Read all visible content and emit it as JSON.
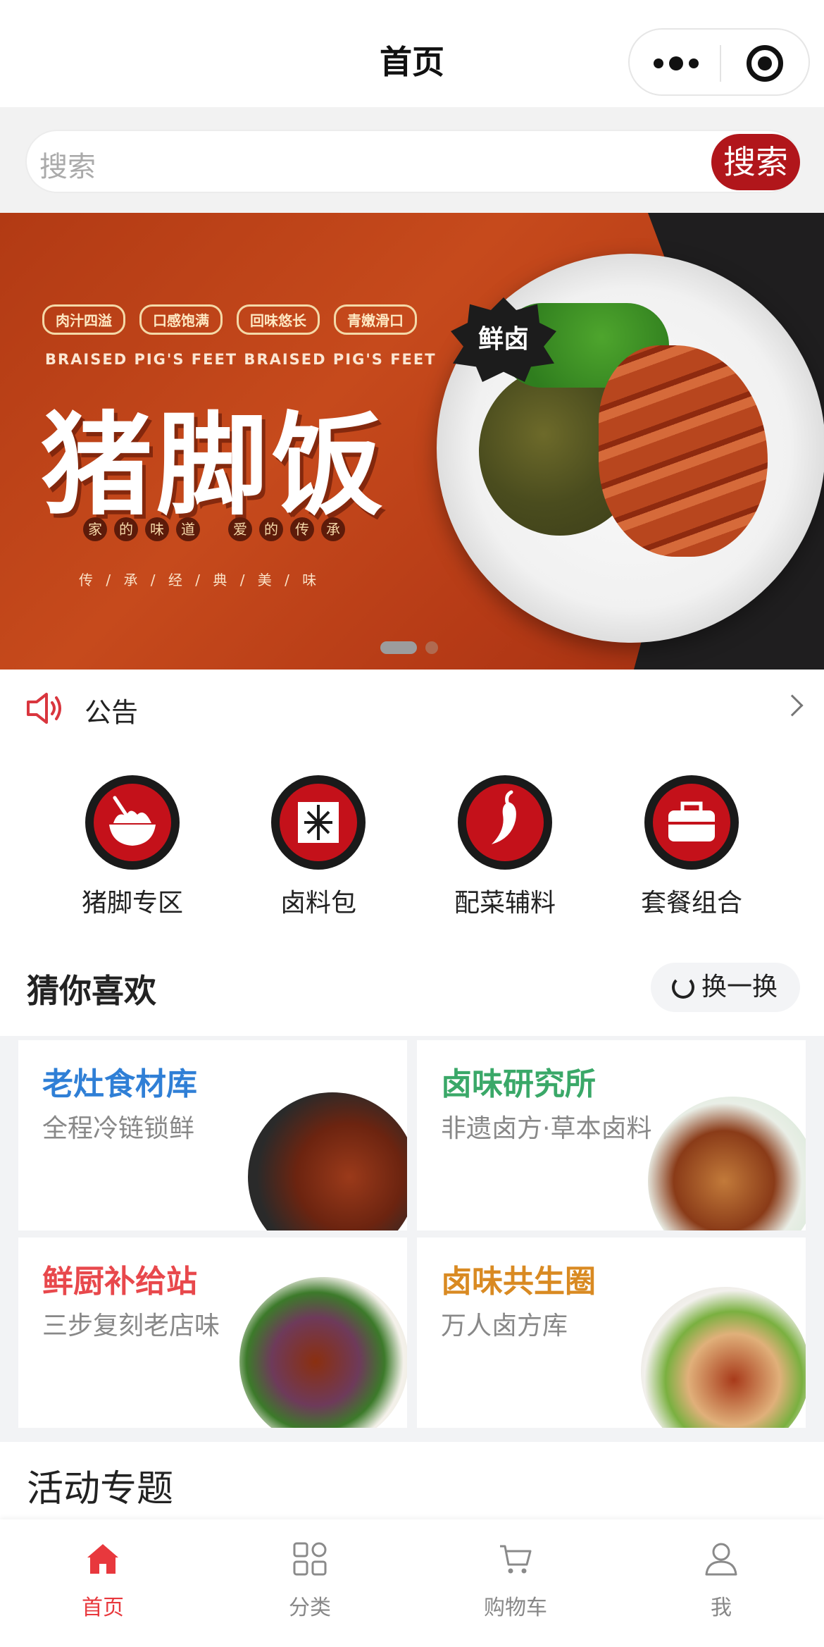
{
  "header": {
    "title": "首页"
  },
  "search": {
    "placeholder": "搜索",
    "button_label": "搜索"
  },
  "banner": {
    "tags": [
      "肉汁四溢",
      "口感饱满",
      "回味悠长",
      "青嫩滑口"
    ],
    "subtitle": "BRAISED PIG'S FEET BRAISED PIG'S FEET",
    "title": "猪脚饭",
    "badge": "鲜卤",
    "motto_left": [
      "家",
      "的",
      "味",
      "道"
    ],
    "motto_right": [
      "爱",
      "的",
      "传",
      "承"
    ],
    "legacy": "传 / 承 / 经 / 典 / 美 / 味",
    "active_slide": 1,
    "slide_count": 2
  },
  "notice": {
    "label": "公告"
  },
  "categories": [
    {
      "label": "猪脚专区",
      "icon": "rice-bowl-icon"
    },
    {
      "label": "卤料包",
      "icon": "spice-pack-icon"
    },
    {
      "label": "配菜辅料",
      "icon": "chili-icon"
    },
    {
      "label": "套餐组合",
      "icon": "lunchbox-icon"
    }
  ],
  "guess": {
    "title": "猜你喜欢",
    "refresh_label": "换一换",
    "cards": [
      {
        "title": "老灶食材库",
        "subtitle": "全程冷链锁鲜",
        "title_color": "#2f7fd6"
      },
      {
        "title": "卤味研究所",
        "subtitle": "非遗卤方·草本卤料",
        "title_color": "#3aa868"
      },
      {
        "title": "鲜厨补给站",
        "subtitle": "三步复刻老店味",
        "title_color": "#e8484c"
      },
      {
        "title": "卤味共生圈",
        "subtitle": "万人卤方库",
        "title_color": "#d98a22"
      }
    ]
  },
  "activity": {
    "title": "活动专题"
  },
  "tabbar": {
    "items": [
      {
        "label": "首页",
        "icon": "home-icon",
        "active": true
      },
      {
        "label": "分类",
        "icon": "category-icon",
        "active": false
      },
      {
        "label": "购物车",
        "icon": "cart-icon",
        "active": false
      },
      {
        "label": "我",
        "icon": "user-icon",
        "active": false
      }
    ]
  },
  "colors": {
    "brand": "#b1161b",
    "tab_active": "#e8383d"
  }
}
